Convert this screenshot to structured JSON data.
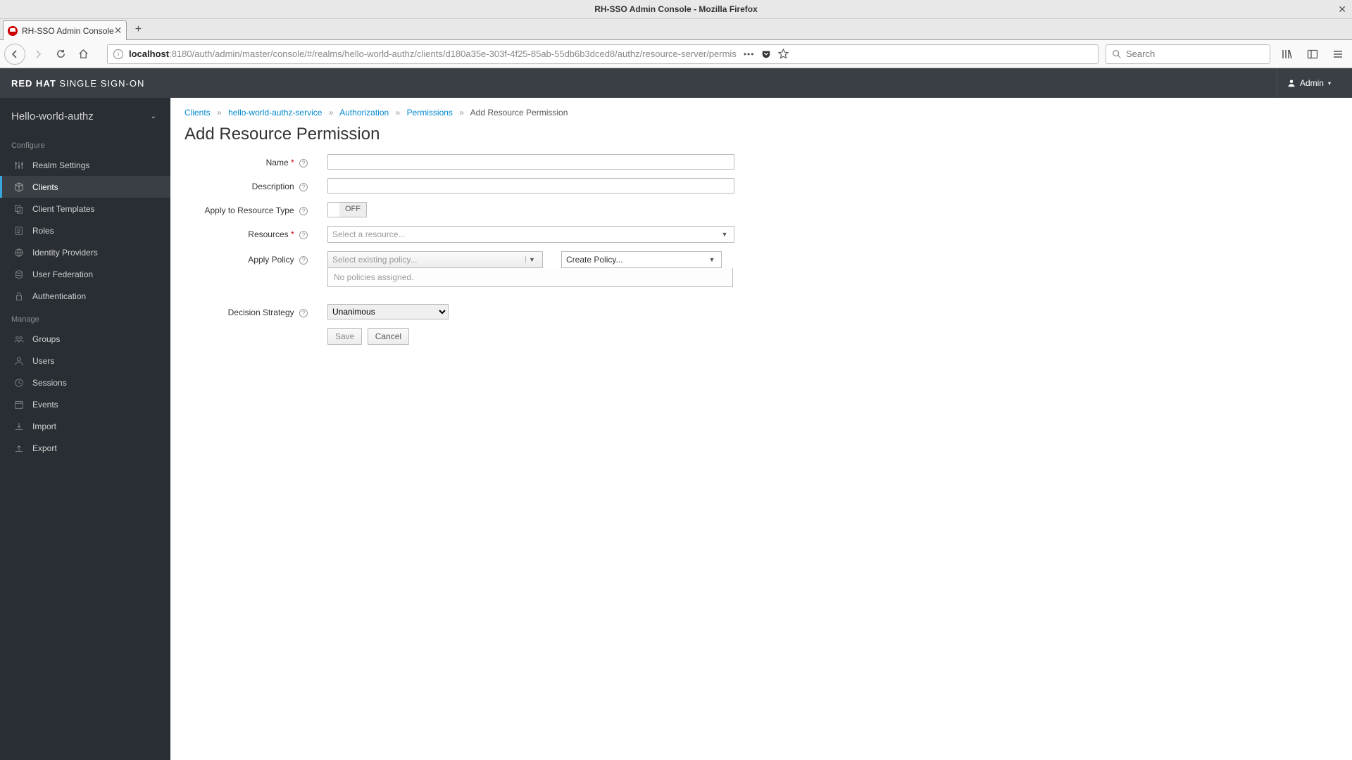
{
  "window": {
    "title": "RH-SSO Admin Console - Mozilla Firefox",
    "tab_title": "RH-SSO Admin Console",
    "url_host": "localhost",
    "url_rest": ":8180/auth/admin/master/console/#/realms/hello-world-authz/clients/d180a35e-303f-4f25-85ab-55db6b3dced8/authz/resource-server/permis",
    "search_placeholder": "Search"
  },
  "header": {
    "brand_bold": "RED HAT",
    "brand_thin": " SINGLE SIGN-ON",
    "user": "Admin"
  },
  "sidebar": {
    "realm": "Hello-world-authz",
    "configure_label": "Configure",
    "manage_label": "Manage",
    "configure": [
      {
        "label": "Realm Settings"
      },
      {
        "label": "Clients"
      },
      {
        "label": "Client Templates"
      },
      {
        "label": "Roles"
      },
      {
        "label": "Identity Providers"
      },
      {
        "label": "User Federation"
      },
      {
        "label": "Authentication"
      }
    ],
    "manage": [
      {
        "label": "Groups"
      },
      {
        "label": "Users"
      },
      {
        "label": "Sessions"
      },
      {
        "label": "Events"
      },
      {
        "label": "Import"
      },
      {
        "label": "Export"
      }
    ]
  },
  "breadcrumb": {
    "items": [
      "Clients",
      "hello-world-authz-service",
      "Authorization",
      "Permissions"
    ],
    "current": "Add Resource Permission"
  },
  "page": {
    "title": "Add Resource Permission",
    "labels": {
      "name": "Name",
      "description": "Description",
      "resource_type": "Apply to Resource Type",
      "resources": "Resources",
      "apply_policy": "Apply Policy",
      "decision_strategy": "Decision Strategy"
    },
    "toggle_off": "OFF",
    "resources_placeholder": "Select a resource...",
    "policy_placeholder": "Select existing policy...",
    "create_policy": "Create Policy...",
    "no_policies": "No policies assigned.",
    "decision_value": "Unanimous",
    "save": "Save",
    "cancel": "Cancel"
  }
}
